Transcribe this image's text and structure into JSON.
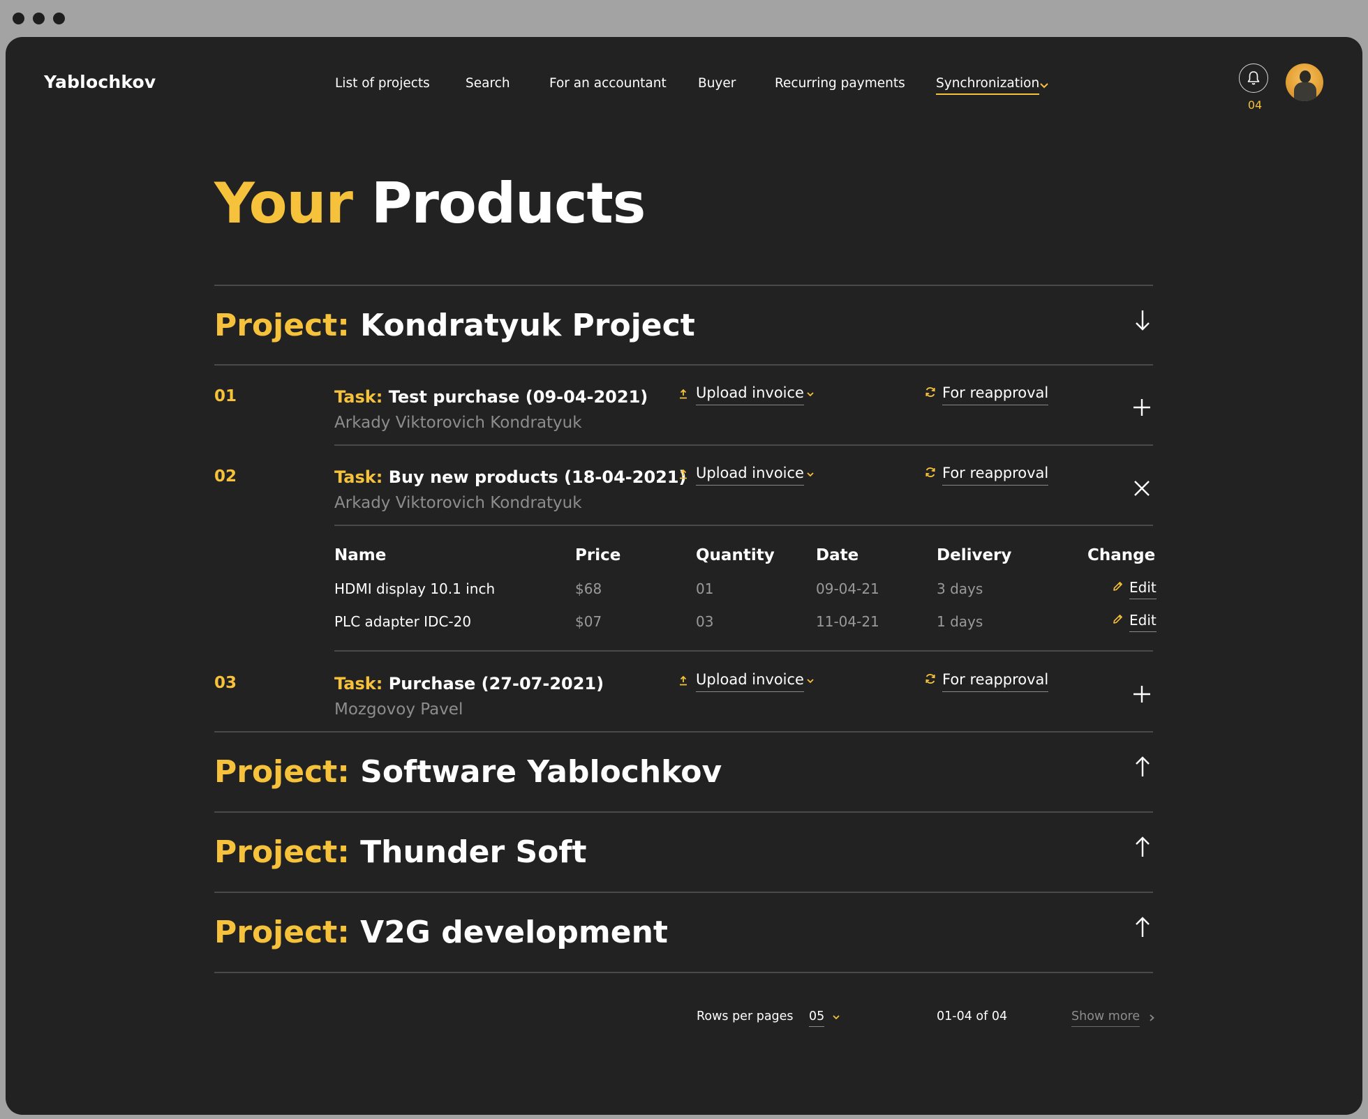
{
  "brand": "Yablochkov",
  "nav": [
    {
      "label": "List of projects"
    },
    {
      "label": "Search"
    },
    {
      "label": "For an accountant"
    },
    {
      "label": "Buyer"
    },
    {
      "label": "Recurring payments"
    },
    {
      "label": "Synchronization",
      "active": true
    }
  ],
  "notifications": {
    "count": "04"
  },
  "page_title": {
    "highlight": "Your",
    "rest": "Products"
  },
  "labels": {
    "project": "Project:",
    "task": "Task:",
    "upload": "Upload invoice",
    "reapproval": "For reapproval",
    "edit": "Edit"
  },
  "projects": [
    {
      "name": "Kondratyuk Project",
      "tasks": [
        {
          "num": "01",
          "title": "Test purchase (09-04-2021)",
          "person": "Arkady Viktorovich Kondratyuk"
        },
        {
          "num": "02",
          "title": "Buy new products (18-04-2021)",
          "person": "Arkady Viktorovich Kondratyuk"
        },
        {
          "num": "03",
          "title": "Purchase (27-07-2021)",
          "person": "Mozgovoy Pavel"
        }
      ]
    },
    {
      "name": "Software Yablochkov"
    },
    {
      "name": "Thunder Soft"
    },
    {
      "name": "V2G development"
    }
  ],
  "table": {
    "headers": [
      "Name",
      "Price",
      "Quantity",
      "Date",
      "Delivery",
      "Change"
    ],
    "rows": [
      {
        "name": "HDMI display 10.1 inch",
        "price": "$68",
        "quantity": "01",
        "date": "09-04-21",
        "delivery": "3 days"
      },
      {
        "name": "PLC adapter IDC-20",
        "price": "$07",
        "quantity": "03",
        "date": "11-04-21",
        "delivery": "1 days"
      }
    ]
  },
  "pagination": {
    "rows_label": "Rows per pages",
    "rows_value": "05",
    "range": "01-04 of 04",
    "show_more": "Show more"
  },
  "colors": {
    "accent": "#f7c23b",
    "background": "#222222",
    "muted": "#8d8d8d"
  },
  "icons": [
    "bell-icon",
    "avatar",
    "upload-icon",
    "refresh-icon",
    "plus-icon",
    "close-icon",
    "arrow-down-icon",
    "arrow-up-icon",
    "pencil-icon",
    "chevron-down-icon",
    "chevron-right-icon"
  ]
}
